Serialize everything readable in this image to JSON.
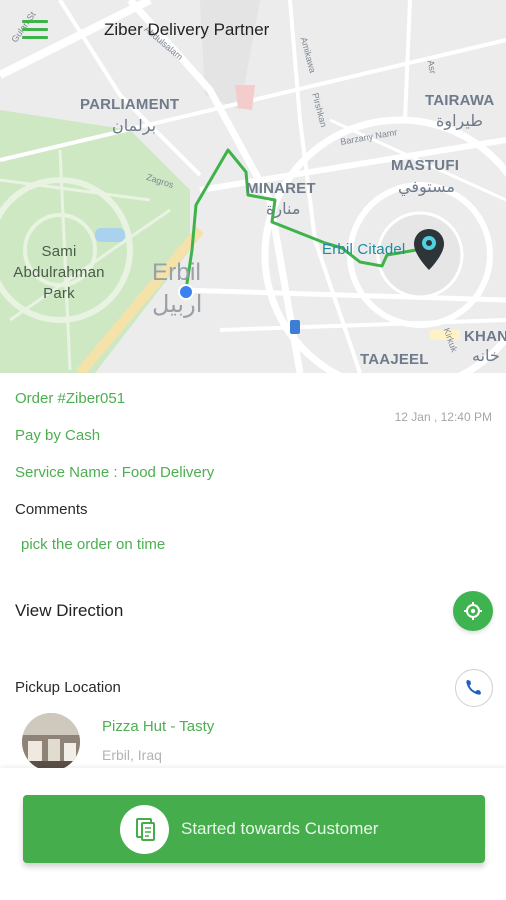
{
  "header": {
    "title": "Ziber Delivery Partner",
    "menu_icon": "hamburger-menu-icon",
    "accent": "#3db34a"
  },
  "map": {
    "labels": {
      "parliament": "PARLIAMENT",
      "parliament_ar": "برلمان",
      "tairawa": "TAIRAWA",
      "tairawa_ar": "طيراوة",
      "mastufi": "MASTUFI",
      "mastufi_ar": "مستوفي",
      "minaret": "MINARET",
      "minaret_ar": "منارة",
      "park_line1": "Sami",
      "park_line2": "Abdulrahman",
      "park_line3": "Park",
      "erbil": "Erbil",
      "erbil_ar": "اربيل",
      "citadel": "Erbil Citadel",
      "taajeel": "TAAJEEL",
      "khan": "KHAN",
      "khan_ar": "خانه"
    },
    "streets": {
      "s1": "Gulan St",
      "s2": "Abdulsalam",
      "s3": "Amikawa",
      "s4": "Pirshkan",
      "s5": "Barzany Namr",
      "s6": "Zagros",
      "s7": "Kirkuk",
      "s8": "Asr"
    },
    "route_color": "#3db34a",
    "destination_icon": "map-pin-icon",
    "origin_icon": "location-dot-icon"
  },
  "order": {
    "number": "Order #Ziber051",
    "payment": "Pay by Cash",
    "service": "Service Name : Food Delivery",
    "date": "12 Jan , 12:40 PM",
    "comments_label": "Comments",
    "comments_text": "pick the order on time",
    "view_direction": "View Direction",
    "navigation_icon": "navigation-target-icon",
    "pickup_label": "Pickup Location",
    "call_icon": "phone-icon",
    "store_name": "Pizza Hut - Tasty",
    "store_location": "Erbil, Iraq"
  },
  "action": {
    "label": "Started towards Customer",
    "icon": "delivery-status-icon",
    "color": "#45ad4c"
  }
}
